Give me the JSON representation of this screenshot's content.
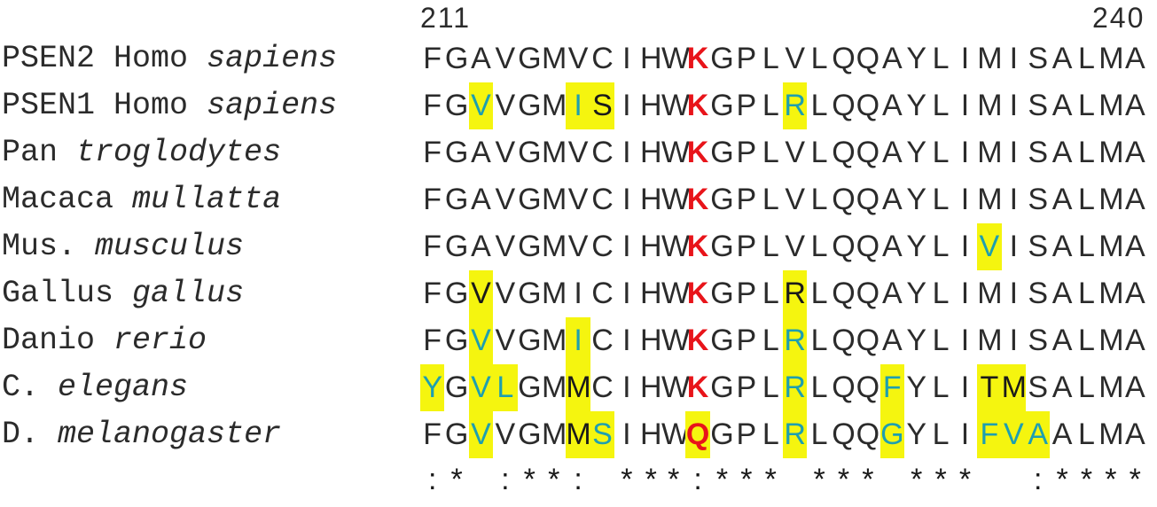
{
  "positions": {
    "start": "211",
    "end": "240"
  },
  "colors": {
    "highlight": "#f5f50f",
    "substitution_text": "#1e9fb0",
    "key_residue": "#e8141a",
    "default_text": "#2b2b2b"
  },
  "rows": [
    {
      "genus": "PSEN2 Homo",
      "epithet": "sapiens",
      "blocks": [
        "FGAVGMVCIH",
        "WKGPLVLQQA",
        "YLIMISALMA"
      ],
      "highlights": {}
    },
    {
      "genus": "PSEN1 Homo",
      "epithet": "sapiens",
      "blocks": [
        "FGVVGMISIH",
        "WKGPLRLQQA",
        "YLIMISALMA"
      ],
      "highlights": {
        "2": "blue",
        "6": "blue",
        "7": "black",
        "15": "blue"
      }
    },
    {
      "genus": "Pan",
      "epithet": "troglodytes",
      "blocks": [
        "FGAVGMVCIH",
        "WKGPLVLQQA",
        "YLIMISALMA"
      ],
      "highlights": {}
    },
    {
      "genus": "Macaca",
      "epithet": "mullatta",
      "blocks": [
        "FGAVGMVCIH",
        "WKGPLVLQQA",
        "YLIMISALMA"
      ],
      "highlights": {}
    },
    {
      "genus": "Mus.",
      "epithet": "musculus",
      "blocks": [
        "FGAVGMVCIH",
        "WKGPLVLQQA",
        "YLIVISALMA"
      ],
      "highlights": {
        "23": "blue"
      }
    },
    {
      "genus": "Gallus",
      "epithet": "gallus",
      "blocks": [
        "FGVVGMICIH",
        "WKGPLRLQQA",
        "YLIMISALMA"
      ],
      "highlights": {
        "2": "black",
        "15": "black"
      }
    },
    {
      "genus": "Danio",
      "epithet": "rerio",
      "blocks": [
        "FGVVGMICIH",
        "WKGPLRLQQA",
        "YLIMISALMA"
      ],
      "highlights": {
        "2": "blue",
        "6": "blue",
        "15": "blue"
      }
    },
    {
      "genus": "C.",
      "epithet": "elegans",
      "blocks": [
        "YGVLGMMCIH",
        "WKGPLRLQQF",
        "YLITMSALMA"
      ],
      "highlights": {
        "0": "blue",
        "2": "blue",
        "3": "blue",
        "6": "black",
        "15": "blue",
        "19": "blue",
        "23": "black",
        "24": "black"
      }
    },
    {
      "genus": "D.",
      "epithet": "melanogaster",
      "blocks": [
        "FGVVGMMSIH",
        "WQGPLRLQQG",
        "YLIFVAALMA"
      ],
      "highlights": {
        "2": "blue",
        "6": "black",
        "7": "blue",
        "11": "red",
        "15": "blue",
        "19": "blue",
        "23": "blue",
        "24": "blue",
        "25": "blue"
      }
    }
  ],
  "key_column": 11,
  "conservation": [
    ":* :**: **",
    "*:*** ***",
    "***  :****"
  ]
}
